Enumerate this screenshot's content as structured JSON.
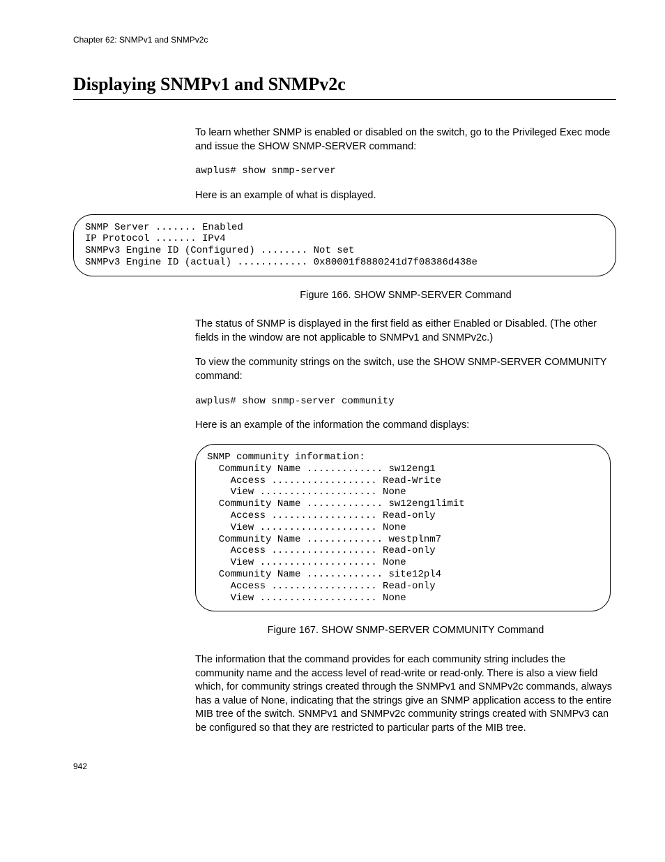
{
  "chapter_header": "Chapter 62: SNMPv1 and SNMPv2c",
  "section_title": "Displaying SNMPv1 and SNMPv2c",
  "para1": "To learn whether SNMP is enabled or disabled on the switch, go to the Privileged Exec mode and issue the SHOW SNMP-SERVER command:",
  "cmd1": "awplus# show snmp-server",
  "para2": "Here is an example of what is displayed.",
  "figure1_content": "SNMP Server ....... Enabled\nIP Protocol ....... IPv4\nSNMPv3 Engine ID (Configured) ........ Not set\nSNMPv3 Engine ID (actual) ............ 0x80001f8880241d7f08386d438e",
  "figure1_caption": "Figure 166. SHOW SNMP-SERVER Command",
  "para3": "The status of SNMP is displayed in the first field as either Enabled or Disabled. (The other fields in the window are not applicable to SNMPv1 and SNMPv2c.)",
  "para4": "To view the community strings on the switch, use the SHOW SNMP-SERVER COMMUNITY command:",
  "cmd2": "awplus# show snmp-server community",
  "para5": "Here is an example of the information the command displays:",
  "figure2_content": "SNMP community information:\n  Community Name ............. sw12eng1\n    Access .................. Read-Write\n    View .................... None\n  Community Name ............. sw12eng1limit\n    Access .................. Read-only\n    View .................... None\n  Community Name ............. westplnm7\n    Access .................. Read-only\n    View .................... None\n  Community Name ............. site12pl4\n    Access .................. Read-only\n    View .................... None",
  "figure2_caption": "Figure 167. SHOW SNMP-SERVER COMMUNITY Command",
  "para6": "The information that the command provides for each community string includes the community name and the access level of read-write or read-only. There is also a view field which, for community strings created through the SNMPv1 and SNMPv2c commands, always has a value of None, indicating that the strings give an SNMP application access to the entire MIB tree of the switch. SNMPv1 and SNMPv2c community strings created with SNMPv3 can be configured so that they are restricted to particular parts of the MIB tree.",
  "page_number": "942"
}
